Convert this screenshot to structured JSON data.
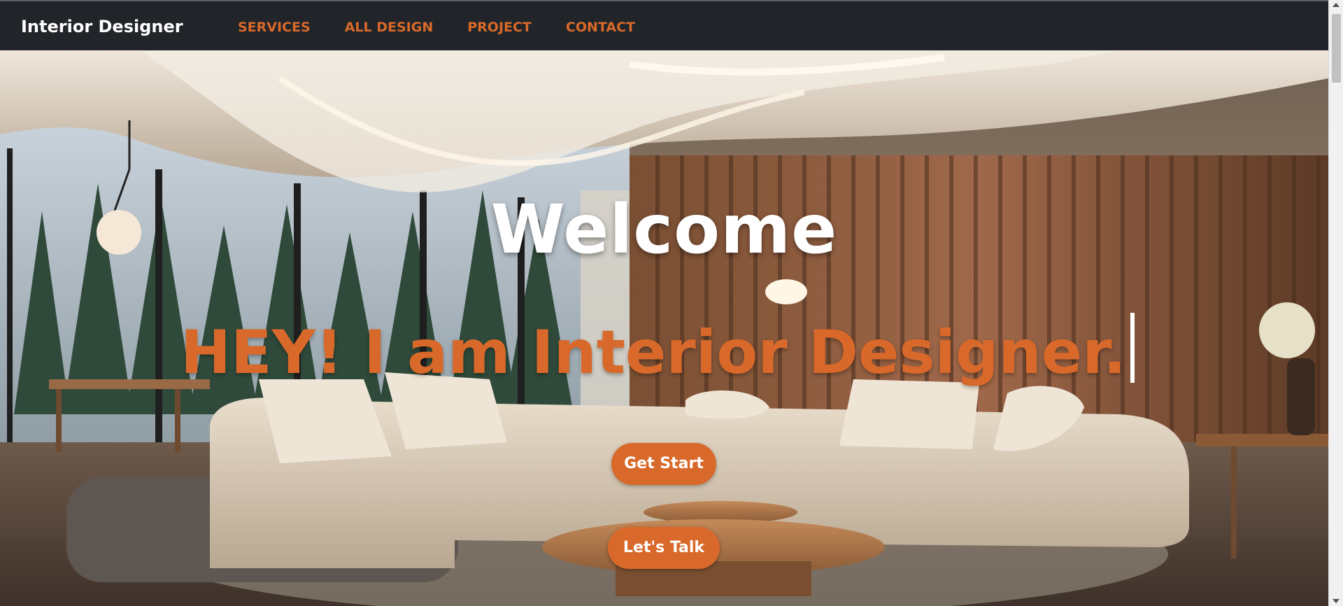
{
  "navbar": {
    "brand": "Interior Designer",
    "links": [
      {
        "label": "SERVICES"
      },
      {
        "label": "ALL DESIGN"
      },
      {
        "label": "PROJECT"
      },
      {
        "label": "CONTACT"
      }
    ]
  },
  "hero": {
    "welcome": "Welcome",
    "tagline": "HEY! I am Interior Designer.",
    "primary_button": "Get Start",
    "secondary_button": "Let's Talk"
  },
  "colors": {
    "accent": "#d9692a",
    "navbar_bg": "#212529",
    "heading": "#ffffff"
  }
}
